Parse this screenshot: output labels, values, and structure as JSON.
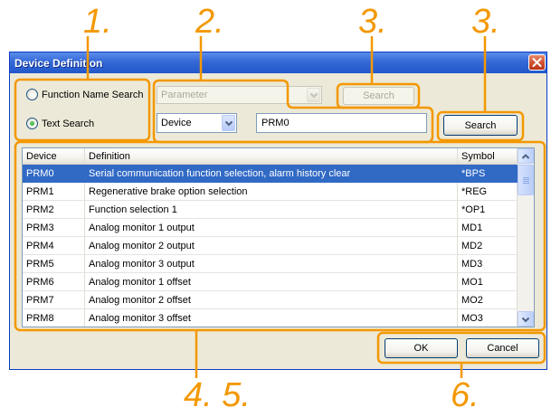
{
  "colors": {
    "accent": "#F39800",
    "title_bar": "#3468D6",
    "selection": "#316AC5"
  },
  "icons": {
    "close": "close-icon",
    "dropdown": "chevron-down-icon",
    "scroll_up": "chevron-up-icon",
    "scroll_down": "chevron-down-icon"
  },
  "callouts": {
    "label_1": "1.",
    "label_2": "2.",
    "label_3_parameter": "3.",
    "label_3_text": "3.",
    "label_4_5": "4. 5.",
    "label_6": "6."
  },
  "dialog": {
    "title": "Device Definition",
    "search_mode": {
      "function_name": {
        "label": "Function Name Search",
        "checked": false
      },
      "text_search": {
        "label": "Text Search",
        "checked": true
      }
    },
    "parameter_select": {
      "value": "Parameter",
      "enabled": false
    },
    "device_select": {
      "value": "Device",
      "enabled": true
    },
    "search_text": {
      "value": "PRM0"
    },
    "search_button_parameter": {
      "label": "Search",
      "enabled": false
    },
    "search_button_text": {
      "label": "Search",
      "enabled": true
    },
    "table": {
      "columns": {
        "device": "Device",
        "definition": "Definition",
        "symbol": "Symbol"
      },
      "rows": [
        {
          "device": "PRM0",
          "definition": "Serial communication function selection, alarm history clear",
          "symbol": "*BPS",
          "selected": true
        },
        {
          "device": "PRM1",
          "definition": "Regenerative brake option selection",
          "symbol": "*REG",
          "selected": false
        },
        {
          "device": "PRM2",
          "definition": "Function selection 1",
          "symbol": "*OP1",
          "selected": false
        },
        {
          "device": "PRM3",
          "definition": "Analog monitor 1 output",
          "symbol": "MD1",
          "selected": false
        },
        {
          "device": "PRM4",
          "definition": "Analog monitor 2 output",
          "symbol": "MD2",
          "selected": false
        },
        {
          "device": "PRM5",
          "definition": "Analog monitor 3 output",
          "symbol": "MD3",
          "selected": false
        },
        {
          "device": "PRM6",
          "definition": "Analog monitor 1 offset",
          "symbol": "MO1",
          "selected": false
        },
        {
          "device": "PRM7",
          "definition": "Analog monitor 2 offset",
          "symbol": "MO2",
          "selected": false
        },
        {
          "device": "PRM8",
          "definition": "Analog monitor 3 offset",
          "symbol": "MO3",
          "selected": false
        }
      ]
    },
    "ok_button": "OK",
    "cancel_button": "Cancel"
  }
}
